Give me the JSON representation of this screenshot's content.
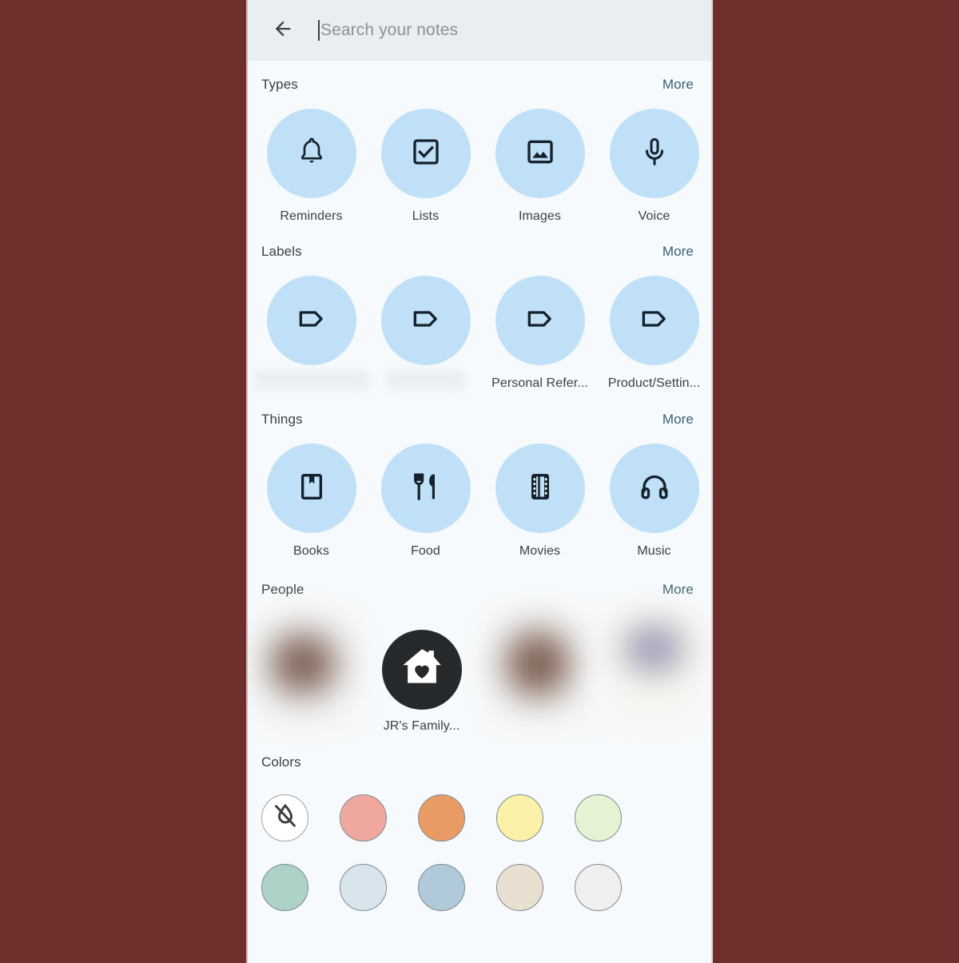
{
  "window": {
    "background_color": "#6f2f2c",
    "app_background": "#f7fafc"
  },
  "search": {
    "back_icon": "arrow-back-icon",
    "placeholder": "Search your notes",
    "value": "",
    "bar_color": "#e9eef0"
  },
  "sections": {
    "types": {
      "title": "Types",
      "more_label": "More",
      "items": [
        {
          "label": "Reminders",
          "icon": "bell-icon"
        },
        {
          "label": "Lists",
          "icon": "checkbox-icon"
        },
        {
          "label": "Images",
          "icon": "image-icon"
        },
        {
          "label": "Voice",
          "icon": "microphone-icon"
        }
      ]
    },
    "labels": {
      "title": "Labels",
      "more_label": "More",
      "items": [
        {
          "label": "",
          "icon": "label-tag-icon",
          "redacted": true
        },
        {
          "label": "",
          "icon": "label-tag-icon",
          "redacted": true
        },
        {
          "label": "Personal Refer...",
          "icon": "label-tag-icon",
          "redacted": false
        },
        {
          "label": "Product/Settin...",
          "icon": "label-tag-icon",
          "redacted": false
        }
      ]
    },
    "things": {
      "title": "Things",
      "more_label": "More",
      "items": [
        {
          "label": "Books",
          "icon": "book-bookmark-icon"
        },
        {
          "label": "Food",
          "icon": "fork-knife-icon"
        },
        {
          "label": "Movies",
          "icon": "film-strip-icon"
        },
        {
          "label": "Music",
          "icon": "headphones-icon"
        }
      ]
    },
    "people": {
      "title": "People",
      "more_label": "More",
      "items": [
        {
          "label": "",
          "avatar": "blurred-photo-avatar",
          "redacted": true
        },
        {
          "label": "JR's Family...",
          "avatar": "house-heart-icon",
          "redacted": false
        },
        {
          "label": "",
          "avatar": "blurred-photo-avatar",
          "redacted": true
        },
        {
          "label": "",
          "avatar": "blurred-photo-avatar",
          "redacted": true
        }
      ]
    },
    "colors": {
      "title": "Colors",
      "swatches": [
        {
          "name": "No color",
          "hex": "#ffffff",
          "icon": "no-color-icon"
        },
        {
          "name": "Coral",
          "hex": "#f0a79e",
          "icon": ""
        },
        {
          "name": "Peach",
          "hex": "#e89b64",
          "icon": ""
        },
        {
          "name": "Sand",
          "hex": "#fbf1a8",
          "icon": ""
        },
        {
          "name": "Mint",
          "hex": "#e5f3d5",
          "icon": ""
        },
        {
          "name": "Sage",
          "hex": "#aed2c8",
          "icon": ""
        },
        {
          "name": "Fog",
          "hex": "#d8e5ed",
          "icon": ""
        },
        {
          "name": "Storm",
          "hex": "#b0cad9",
          "icon": ""
        },
        {
          "name": "Dusk",
          "hex": "#e8dfd0",
          "icon": ""
        },
        {
          "name": "Chalk",
          "hex": "#f0eeee",
          "icon": ""
        }
      ]
    }
  },
  "theme": {
    "chip_circle_color": "#bfe0f7",
    "more_link_color": "#37616f",
    "text_color": "#3c4043",
    "avatar_icon_bg": "#26292b"
  }
}
